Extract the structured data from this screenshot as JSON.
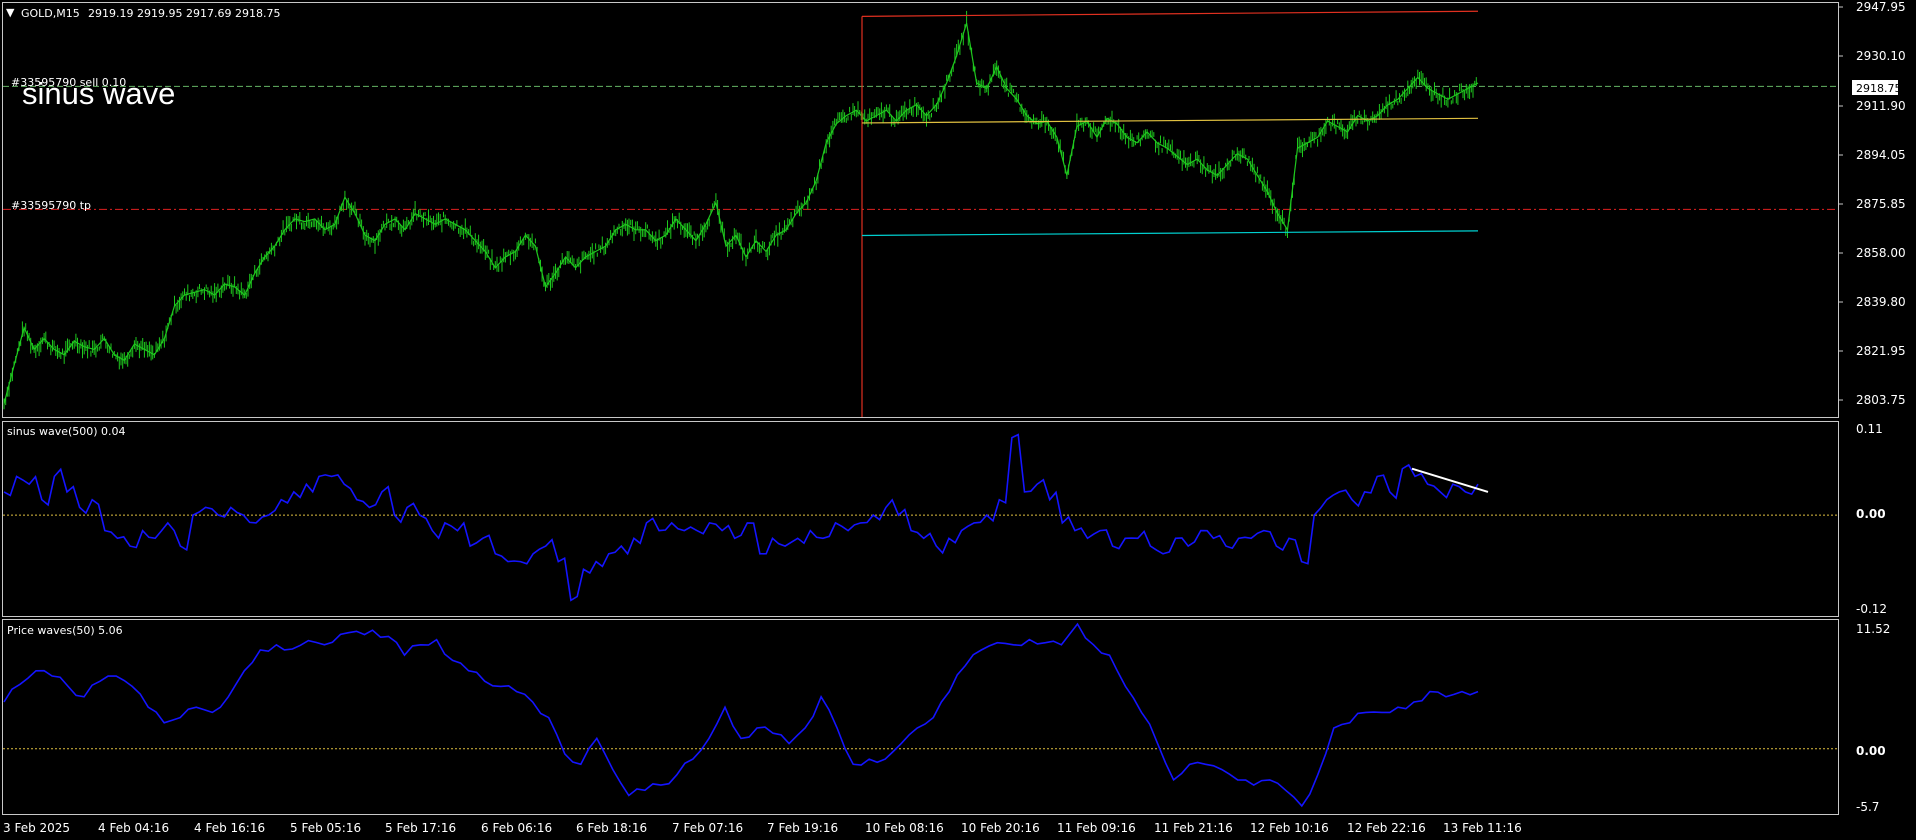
{
  "header": {
    "menu_icon": "triangle-down-icon",
    "symbol_label": "GOLD,M15",
    "ohlc_text": "2919.19 2919.95 2917.69 2918.75"
  },
  "overlay_title": "sinus wave",
  "orders": {
    "sell_label": "#33595790 sell 0.10",
    "tp_label": "#33595790 tp"
  },
  "current_price": "2918.75",
  "colors": {
    "background": "#000000",
    "candles": "#1ec81e",
    "indicator": "#1414ff",
    "sell_line": "#64b464",
    "tp_line": "#e02020",
    "channel_top": "#e03020",
    "channel_mid": "#e0c040",
    "channel_bottom": "#00d0d0",
    "vertical_line": "#e03020",
    "zero_line": "#e0c040",
    "trend_line": "#ffffff",
    "axis": "#c8c8c8"
  },
  "price_axis": [
    "2947.95",
    "2930.10",
    "2911.90",
    "2894.05",
    "2875.85",
    "2858.00",
    "2839.80",
    "2821.95",
    "2803.75"
  ],
  "panels": [
    {
      "name": "sinus wave",
      "label": "sinus wave(500) 0.04",
      "axis_labels": [
        "0.11",
        "0.00",
        "-0.12"
      ]
    },
    {
      "name": "price waves",
      "label": "Price waves(50) 5.06",
      "axis_labels": [
        "11.52",
        "0.00",
        "-5.7"
      ]
    }
  ],
  "time_axis": [
    "3 Feb 2025",
    "4 Feb 04:16",
    "4 Feb 16:16",
    "5 Feb 05:16",
    "5 Feb 17:16",
    "6 Feb 06:16",
    "6 Feb 18:16",
    "7 Feb 07:16",
    "7 Feb 19:16",
    "10 Feb 08:16",
    "10 Feb 20:16",
    "11 Feb 09:16",
    "11 Feb 21:16",
    "12 Feb 10:16",
    "12 Feb 22:16",
    "13 Feb 11:16"
  ],
  "chart_data": [
    {
      "type": "line",
      "title": "GOLD,M15",
      "x_labels": [
        "3 Feb 2025",
        "4 Feb 04:16",
        "4 Feb 16:16",
        "5 Feb 05:16",
        "5 Feb 17:16",
        "6 Feb 06:16",
        "6 Feb 18:16",
        "7 Feb 07:16",
        "7 Feb 19:16",
        "10 Feb 08:16",
        "10 Feb 20:16",
        "11 Feb 09:16",
        "11 Feb 21:16",
        "12 Feb 10:16",
        "12 Feb 22:16",
        "13 Feb 11:16"
      ],
      "ylim": [
        2797,
        2950
      ],
      "series": [
        {
          "values": [
            2802,
            2816,
            2830,
            2822,
            2826,
            2822,
            2820,
            2825,
            2823,
            2822,
            2826,
            2820,
            2818,
            2824,
            2822,
            2820,
            2826,
            2838,
            2842,
            2843,
            2844,
            2842,
            2846,
            2845,
            2842,
            2850,
            2856,
            2860,
            2866,
            2870,
            2869,
            2870,
            2866,
            2868,
            2878,
            2872,
            2864,
            2862,
            2868,
            2870,
            2866,
            2872,
            2870,
            2868,
            2870,
            2868,
            2866,
            2862,
            2858,
            2852,
            2856,
            2858,
            2864,
            2860,
            2845,
            2850,
            2856,
            2852,
            2856,
            2858,
            2860,
            2866,
            2868,
            2866,
            2866,
            2862,
            2864,
            2870,
            2866,
            2862,
            2868,
            2876,
            2860,
            2864,
            2856,
            2862,
            2858,
            2864,
            2866,
            2872,
            2876,
            2884,
            2898,
            2905,
            2908,
            2910,
            2906,
            2908,
            2910,
            2906,
            2910,
            2912,
            2908,
            2912,
            2920,
            2930,
            2942,
            2920,
            2918,
            2926,
            2918,
            2914,
            2908,
            2905,
            2906,
            2900,
            2886,
            2904,
            2906,
            2900,
            2907,
            2905,
            2900,
            2898,
            2902,
            2898,
            2896,
            2893,
            2890,
            2892,
            2888,
            2886,
            2890,
            2894,
            2892,
            2886,
            2880,
            2872,
            2866,
            2896,
            2898,
            2900,
            2906,
            2904,
            2902,
            2908,
            2906,
            2908,
            2912,
            2914,
            2918,
            2922,
            2918,
            2916,
            2914,
            2916,
            2918,
            2920
          ]
        }
      ],
      "reference_lines": [
        {
          "label": "#33595790 sell 0.10",
          "value": 2918.75
        },
        {
          "label": "#33595790 tp",
          "value": 2873.5
        }
      ],
      "regression_channel": {
        "top": [
          2944.5,
          2946.4
        ],
        "middle": [
          2905.3,
          2907.0
        ],
        "bottom": [
          2863.9,
          2865.6
        ]
      }
    },
    {
      "type": "line",
      "title": "sinus wave(500) 0.04",
      "ylim": [
        -0.12,
        0.11
      ],
      "series": [
        {
          "values": [
            0.03,
            0.05,
            0.04,
            0.02,
            0.05,
            0.03,
            0.01,
            0.02,
            -0.02,
            -0.03,
            -0.04,
            -0.02,
            -0.03,
            -0.01,
            -0.04,
            0.0,
            0.01,
            0.0,
            0.01,
            0.0,
            -0.01,
            0.0,
            0.02,
            0.03,
            0.04,
            0.05,
            0.05,
            0.04,
            0.02,
            0.01,
            0.03,
            0.0,
            0.01,
            0.0,
            -0.02,
            -0.01,
            -0.02,
            -0.04,
            -0.03,
            -0.05,
            -0.06,
            -0.06,
            -0.05,
            -0.04,
            -0.06,
            -0.11,
            -0.07,
            -0.06,
            -0.05,
            -0.04,
            -0.03,
            -0.01,
            -0.02,
            -0.01,
            -0.02,
            -0.02,
            -0.01,
            -0.02,
            -0.03,
            -0.01,
            -0.05,
            -0.03,
            -0.04,
            -0.03,
            -0.02,
            -0.03,
            -0.01,
            -0.02,
            -0.01,
            0.0,
            0.01,
            0.0,
            -0.02,
            -0.03,
            -0.04,
            -0.03,
            -0.02,
            -0.01,
            0.0,
            0.02,
            0.1,
            0.03,
            0.04,
            0.02,
            -0.01,
            -0.02,
            -0.03,
            -0.02,
            -0.04,
            -0.03,
            -0.03,
            -0.04,
            -0.05,
            -0.03,
            -0.04,
            -0.02,
            -0.03,
            -0.04,
            -0.03,
            -0.03,
            -0.02,
            -0.04,
            -0.03,
            -0.06,
            0.0,
            0.02,
            0.03,
            0.02,
            0.03,
            0.05,
            0.03,
            0.06,
            0.05,
            0.04,
            0.03,
            0.04,
            0.03,
            0.04
          ]
        }
      ],
      "trend_line": [
        0.06,
        0.03
      ]
    },
    {
      "type": "line",
      "title": "Price waves(50) 5.06",
      "ylim": [
        -5.7,
        11.52
      ],
      "series": [
        {
          "values": [
            4.5,
            6.2,
            7.5,
            7.0,
            6.0,
            5.0,
            6.5,
            7.0,
            6.0,
            4.0,
            2.5,
            3.0,
            4.0,
            3.5,
            5.0,
            7.5,
            9.5,
            10.0,
            9.6,
            10.4,
            10.0,
            11.0,
            11.3,
            11.4,
            10.8,
            9.0,
            10.0,
            10.5,
            8.5,
            7.5,
            6.5,
            6.0,
            5.5,
            4.5,
            3.0,
            -0.5,
            -1.5,
            1.0,
            -2.0,
            -4.5,
            -4.0,
            -3.5,
            -2.5,
            -1.0,
            1.0,
            4.0,
            1.0,
            2.0,
            1.5,
            0.5,
            2.0,
            5.0,
            2.0,
            -1.5,
            -1.0,
            -1.0,
            0.5,
            2.0,
            3.0,
            5.5,
            8.0,
            9.5,
            10.2,
            10.0,
            10.5,
            10.2,
            10.0,
            12.0,
            10.0,
            9.0,
            6.0,
            3.5,
            0.5,
            -3.0,
            -1.5,
            -1.5,
            -2.0,
            -3.0,
            -3.5,
            -3.0,
            -4.0,
            -5.5,
            -2.5,
            2.0,
            2.5,
            3.5,
            3.5,
            4.0,
            4.5,
            5.5,
            5.0,
            5.5,
            5.5
          ]
        }
      ]
    }
  ]
}
